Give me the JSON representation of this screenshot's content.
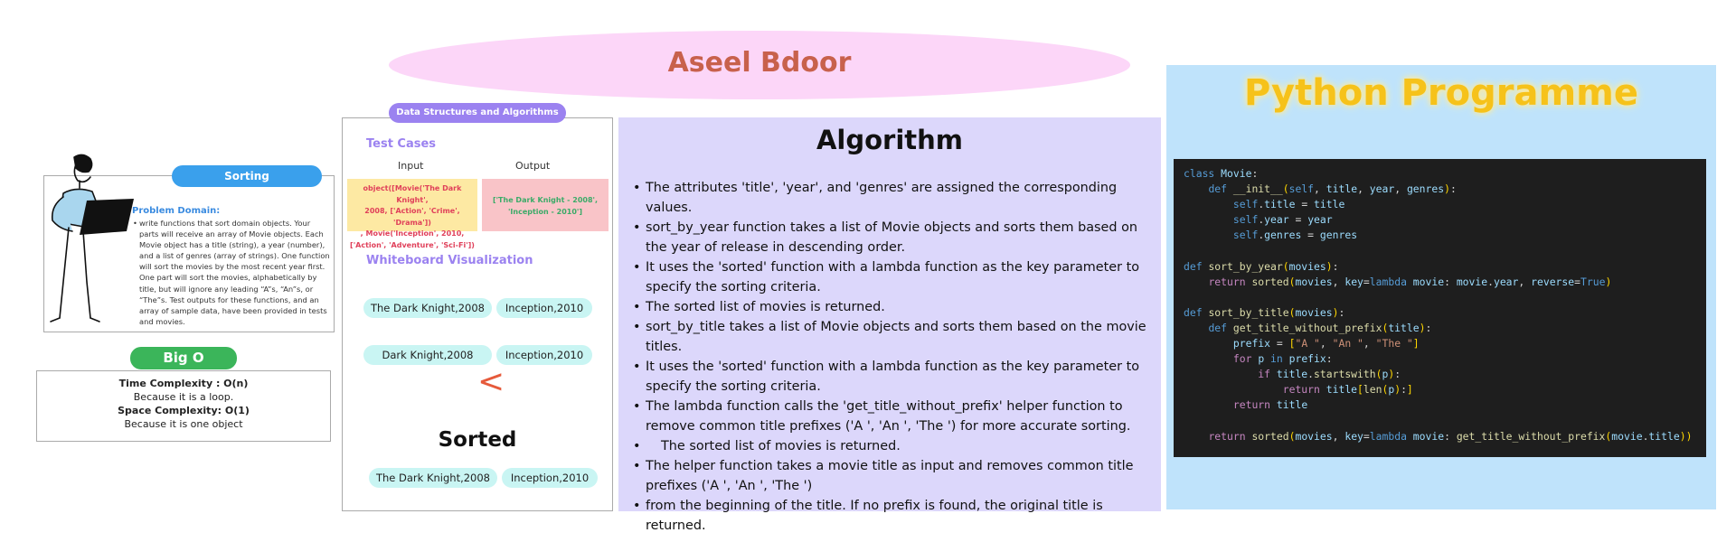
{
  "title": "Aseel Bdoor",
  "problem": {
    "pill": "Sorting",
    "heading": "Problem Domain:",
    "body": "write functions that sort domain objects. Your parts will receive an array of Movie objects. Each Movie object has a title (string), a year (number), and a list of genres (array of strings). One function will sort the movies by the most recent year first. One part will sort the movies, alphabetically by title, but will ignore any leading “A”s, “An”s, or “The”s. Test outputs for these functions, and an array of sample data, have been provided in tests and movies."
  },
  "big_o": {
    "pill": "Big O",
    "time_label": "Time Complexity : O(n)",
    "time_reason": "Because it is a loop.",
    "space_label": "Space Complexity: O(1)",
    "space_reason": "Because it is one object"
  },
  "dsa": {
    "pill": "Data Structures and Algorithms",
    "test_cases_heading": "Test Cases",
    "input_label": "Input",
    "output_label": "Output",
    "input_lines": [
      "object([Movie('The Dark Knight',",
      "2008, ['Action', 'Crime', 'Drama'])",
      ", Movie('Inception', 2010,",
      "['Action', 'Adventure', 'Sci-Fi'])"
    ],
    "output_lines": [
      "['The Dark Knight - 2008',",
      "'Inception - 2010']"
    ],
    "whiteboard_heading": "Whiteboard Visualization",
    "chips_row1": [
      "The Dark Knight,2008",
      "Inception,2010"
    ],
    "chips_row2": [
      "Dark Knight,2008",
      "Inception,2010"
    ],
    "compare_symbol": "<",
    "sorted_heading": "Sorted",
    "chips_sorted": [
      "The Dark Knight,2008",
      "Inception,2010"
    ]
  },
  "algorithm": {
    "heading": "Algorithm",
    "items": [
      "The attributes 'title', 'year', and 'genres' are assigned the corresponding values.",
      "sort_by_year function takes a list of Movie objects and sorts them based on the year of release in descending order.",
      "It uses the 'sorted' function with a lambda function as the key parameter to specify the sorting criteria.",
      "The sorted list of movies is returned.",
      "sort_by_title takes a list of Movie objects and sorts them based on the movie titles.",
      "It uses the 'sorted' function with a lambda function as the key parameter to specify the sorting criteria.",
      "The lambda function calls the 'get_title_without_prefix' helper function to remove common title prefixes ('A ', 'An ', 'The ') for more accurate sorting.",
      "The sorted list of movies is returned.",
      "The helper function takes a movie title as input and removes common title prefixes ('A ', 'An ', 'The ')",
      "from the beginning of the title. If no prefix is found, the original title is returned."
    ]
  },
  "python": {
    "heading": "Python Programme",
    "code_lines": [
      "class Movie:",
      "    def __init__(self, title, year, genres):",
      "        self.title = title",
      "        self.year = year",
      "        self.genres = genres",
      "",
      "def sort_by_year(movies):",
      "    return sorted(movies, key=lambda movie: movie.year, reverse=True)",
      "",
      "def sort_by_title(movies):",
      "    def get_title_without_prefix(title):",
      "        prefix = [\"A \", \"An \", \"The \"]",
      "        for p in prefix:",
      "            if title.startswith(p):",
      "                return title[len(p):]",
      "        return title",
      "",
      "    return sorted(movies, key=lambda movie: get_title_without_prefix(movie.title))"
    ]
  },
  "colors": {
    "title_ellipse": "#fcd6f8",
    "title_text": "#c8614c",
    "sorting_pill": "#3aa0ec",
    "big_o_pill": "#3bb55a",
    "dsa_accent": "#9b82f0",
    "algorithm_panel": "#dcd7fb",
    "python_panel": "#bfe3fb",
    "python_heading": "#f6c21a",
    "code_background": "#1e1e1e"
  },
  "icons": {
    "person": "person-with-laptop-illustration"
  }
}
